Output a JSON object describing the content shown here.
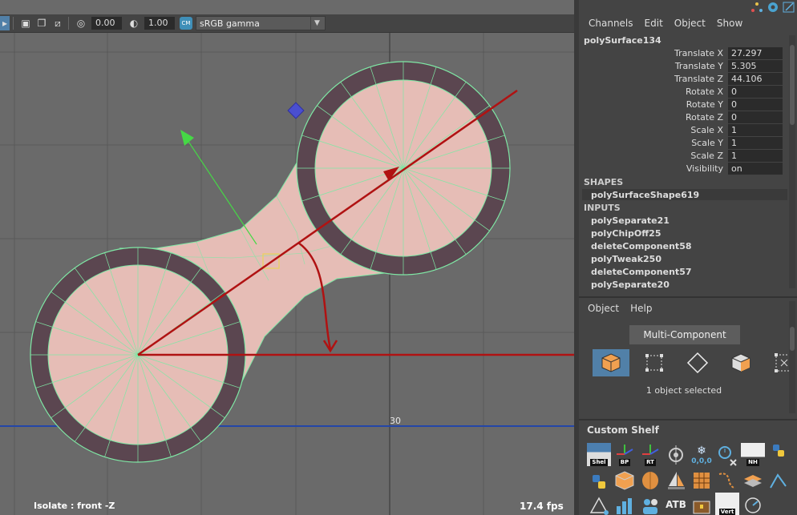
{
  "viewport": {
    "toolbar": {
      "exposure": "0.00",
      "gamma": "1.00",
      "cm_badge": "CM",
      "colorspace": "sRGB gamma"
    },
    "grid_label": "30",
    "hud_left": "Isolate : front -Z",
    "fps": "17.4 fps"
  },
  "channel_box": {
    "menu": [
      "Channels",
      "Edit",
      "Object",
      "Show"
    ],
    "object_name": "polySurface134",
    "channels": [
      {
        "label": "Translate X",
        "value": "27.297"
      },
      {
        "label": "Translate Y",
        "value": "5.305"
      },
      {
        "label": "Translate Z",
        "value": "44.106"
      },
      {
        "label": "Rotate X",
        "value": "0"
      },
      {
        "label": "Rotate Y",
        "value": "0"
      },
      {
        "label": "Rotate Z",
        "value": "0"
      },
      {
        "label": "Scale X",
        "value": "1"
      },
      {
        "label": "Scale Y",
        "value": "1"
      },
      {
        "label": "Scale Z",
        "value": "1"
      },
      {
        "label": "Visibility",
        "value": "on"
      }
    ],
    "shapes_header": "SHAPES",
    "shape": "polySurfaceShape619",
    "inputs_header": "INPUTS",
    "inputs": [
      "polySeparate21",
      "polyChipOff25",
      "deleteComponent58",
      "polyTweak250",
      "deleteComponent57",
      "polySeparate20"
    ]
  },
  "modeling_toolkit": {
    "menu": [
      "Object",
      "Help"
    ],
    "multi_component": "Multi-Component",
    "modes": [
      "object-mode",
      "vertex-mode",
      "edge-mode",
      "face-mode",
      "uv-mode"
    ],
    "status": "1 object selected"
  },
  "shelf": {
    "title": "Custom Shelf",
    "row1": [
      {
        "icon": "shelf-icon",
        "caption": "Shel"
      },
      {
        "icon": "bp-icon",
        "caption": "BP"
      },
      {
        "icon": "rt-icon",
        "caption": "RT"
      },
      {
        "icon": "target-icon",
        "caption": ""
      },
      {
        "icon": "snowflake-icon",
        "caption": "0,0,0"
      },
      {
        "icon": "clock-icon",
        "caption": ""
      },
      {
        "icon": "nh-icon",
        "caption": "NH"
      },
      {
        "icon": "python-icon",
        "caption": ""
      }
    ],
    "row2": [
      {
        "icon": "python2-icon",
        "caption": ""
      },
      {
        "icon": "cube-icon",
        "caption": ""
      },
      {
        "icon": "shell-icon",
        "caption": ""
      },
      {
        "icon": "sail-icon",
        "caption": ""
      },
      {
        "icon": "grid-icon",
        "caption": ""
      },
      {
        "icon": "curve-icon",
        "caption": ""
      },
      {
        "icon": "layers-icon",
        "caption": ""
      },
      {
        "icon": "script-icon",
        "caption": ""
      }
    ],
    "row3": [
      {
        "icon": "triangle-icon",
        "caption": ""
      },
      {
        "icon": "bars-icon",
        "caption": ""
      },
      {
        "icon": "people-icon",
        "caption": ""
      },
      {
        "icon": "atb-icon",
        "caption": "ATB"
      },
      {
        "icon": "chest-icon",
        "caption": ""
      },
      {
        "icon": "eye-icon",
        "caption": "Vert"
      },
      {
        "icon": "dial-icon",
        "caption": ""
      }
    ]
  }
}
